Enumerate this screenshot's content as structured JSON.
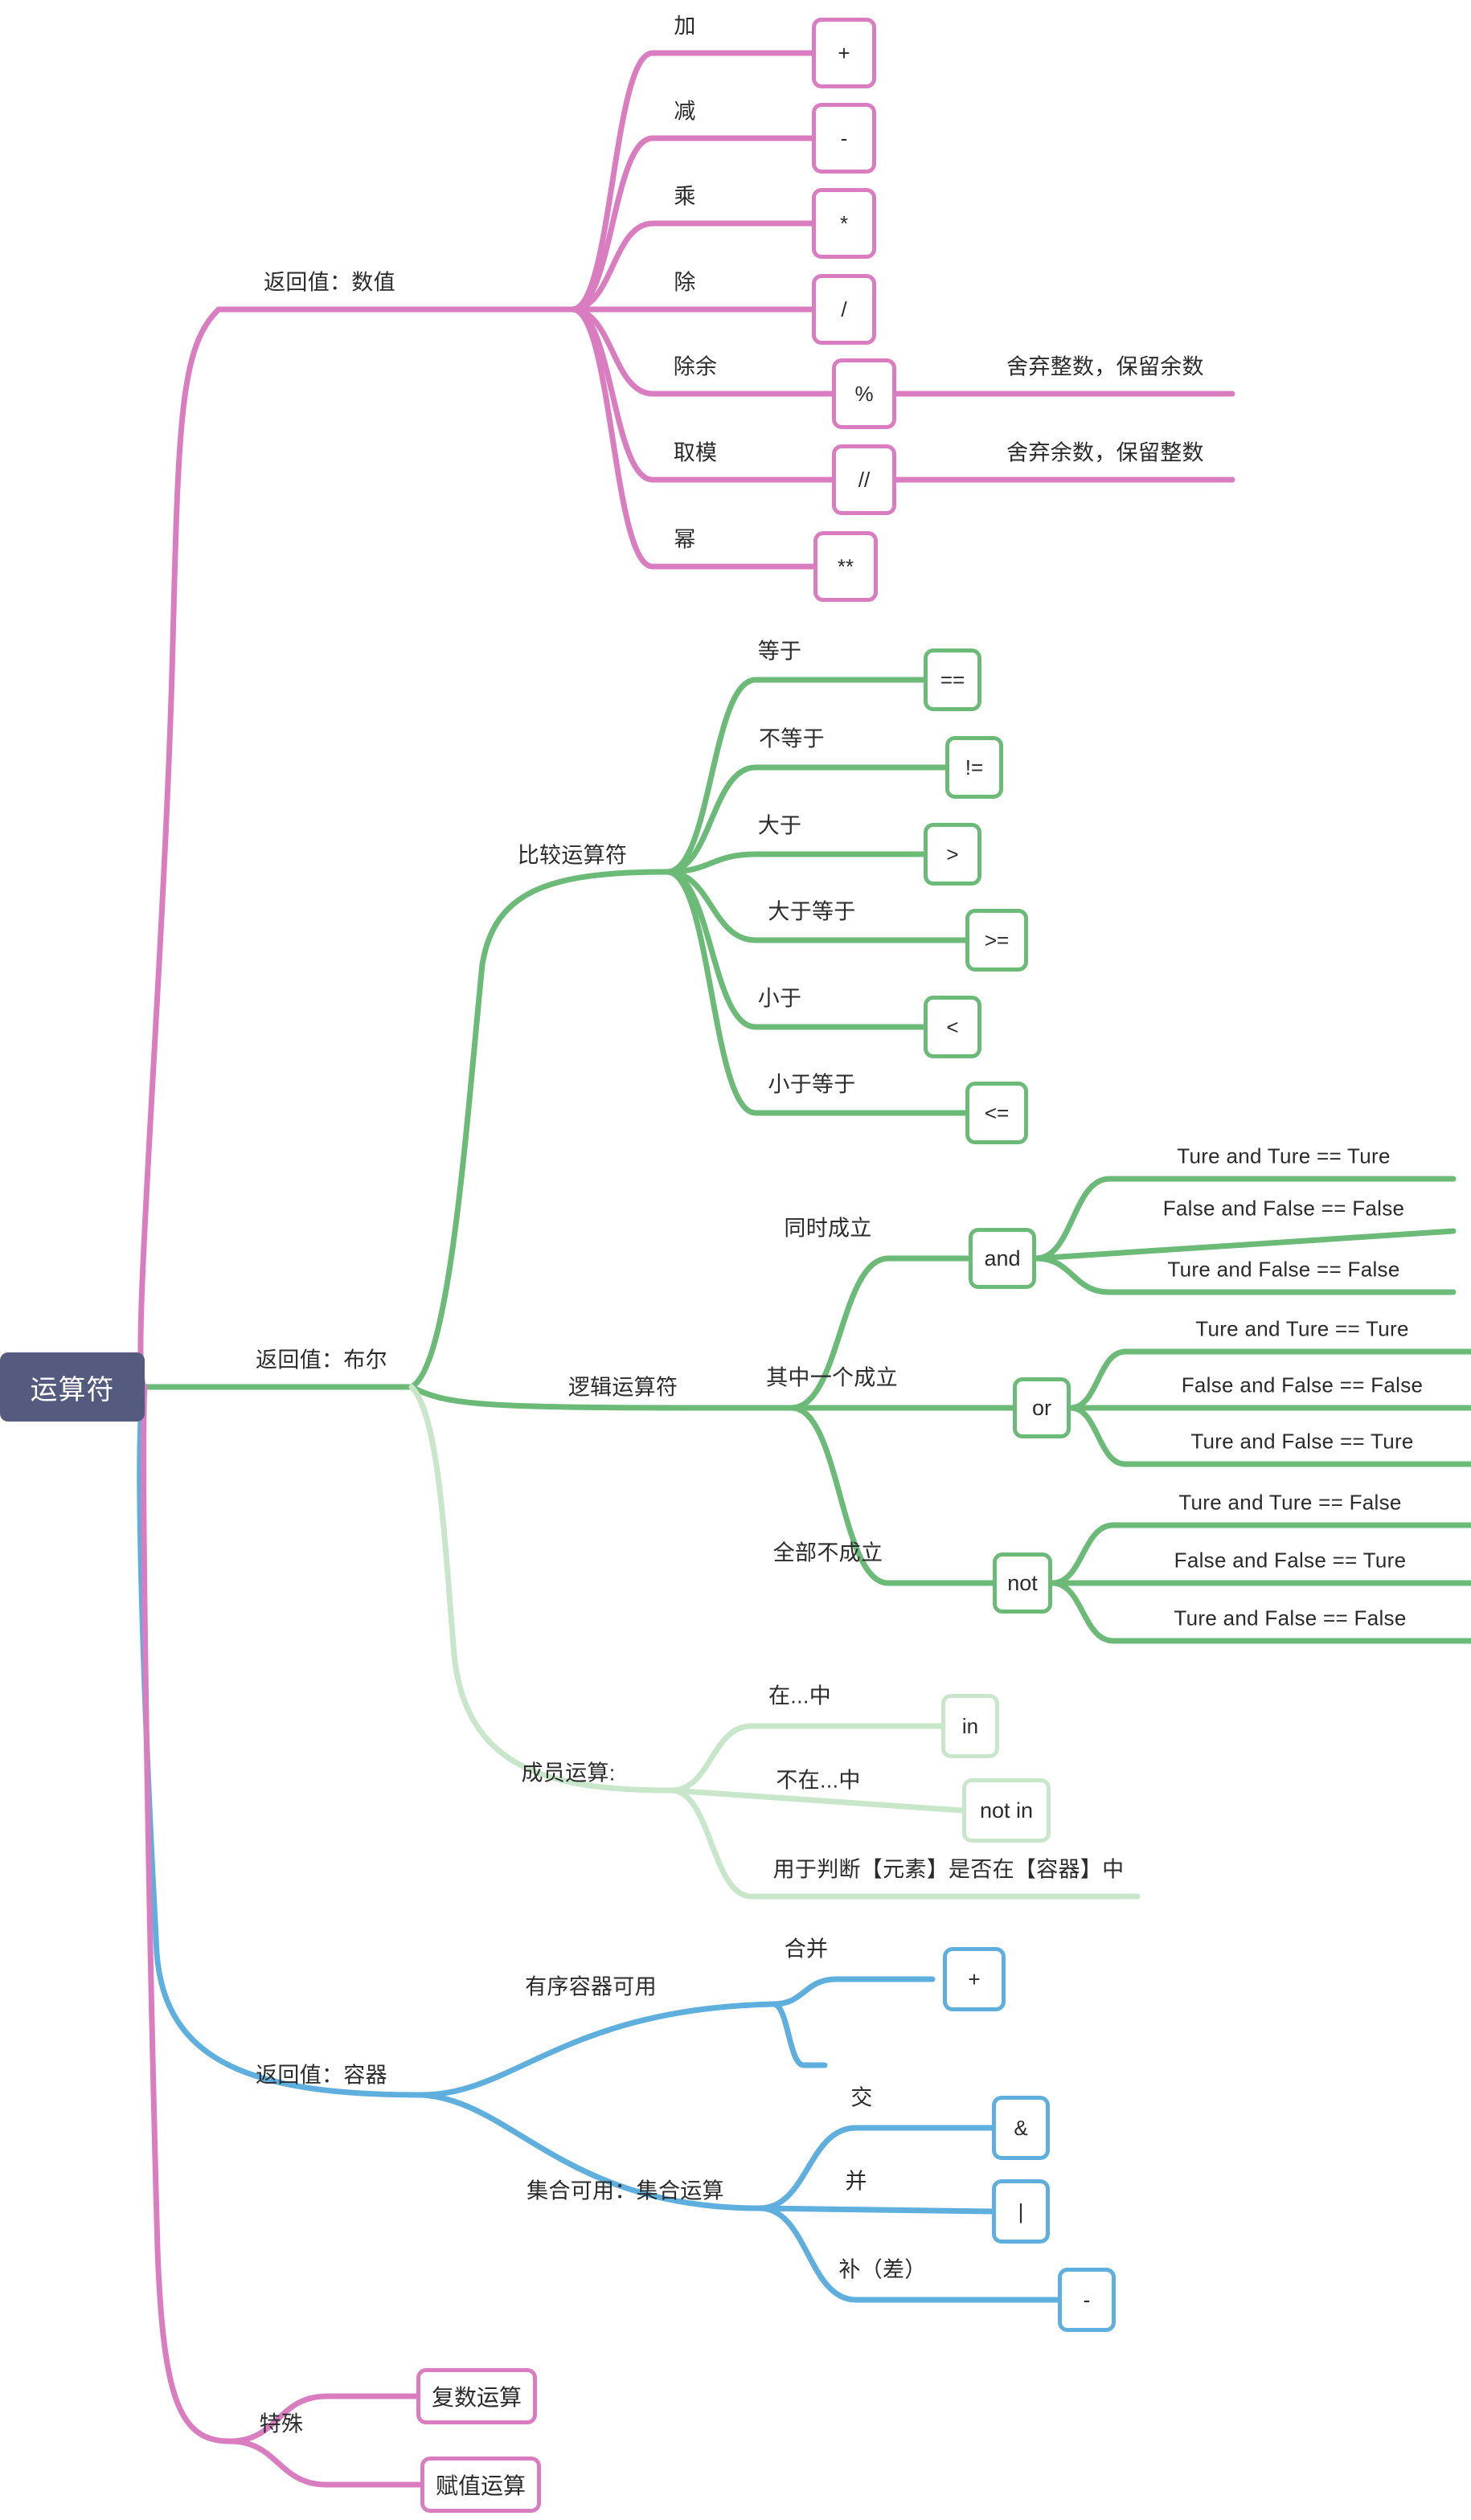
{
  "title": "运算符思维导图",
  "colors": {
    "pink": "#d97dc0",
    "green": "#6cba78",
    "green_light": "#c8e6c9",
    "blue": "#5eafdd",
    "root_bg": "#545b7e",
    "root_text": "#ffffff",
    "text": "#2b2b2b",
    "background": "#ffffff"
  },
  "root": {
    "label": "运算符"
  },
  "branches": {
    "numeric": {
      "label": "返回值：数值",
      "color": "#d97dc0",
      "children": [
        {
          "label": "加",
          "op": "+",
          "note": ""
        },
        {
          "label": "减",
          "op": "-",
          "note": ""
        },
        {
          "label": "乘",
          "op": "*",
          "note": ""
        },
        {
          "label": "除",
          "op": "/",
          "note": ""
        },
        {
          "label": "除余",
          "op": "%",
          "note": "舍弃整数，保留余数"
        },
        {
          "label": "取模",
          "op": "//",
          "note": "舍弃余数，保留整数"
        },
        {
          "label": "幂",
          "op": "**",
          "note": ""
        }
      ]
    },
    "boolean": {
      "label": "返回值：布尔",
      "color": "#6cba78",
      "comparison": {
        "label": "比较运算符",
        "children": [
          {
            "label": "等于",
            "op": "=="
          },
          {
            "label": "不等于",
            "op": "!="
          },
          {
            "label": "大于",
            "op": ">"
          },
          {
            "label": "大于等于",
            "op": ">="
          },
          {
            "label": "小于",
            "op": "<"
          },
          {
            "label": "小于等于",
            "op": "<="
          }
        ]
      },
      "logical": {
        "label": "逻辑运算符",
        "children": [
          {
            "label": "同时成立",
            "op": "and",
            "rules": [
              "Ture and Ture  == Ture",
              "False and False == False",
              "Ture and False == False"
            ]
          },
          {
            "label": "其中一个成立",
            "op": "or",
            "rules": [
              "Ture and Ture  == Ture",
              "False and False == False",
              "Ture and False == Ture"
            ]
          },
          {
            "label": "全部不成立",
            "op": "not",
            "rules": [
              "Ture and Ture  == False",
              "False and False == Ture",
              "Ture and False == False"
            ]
          }
        ]
      },
      "membership": {
        "label": "成员运算:",
        "children": [
          {
            "label": "在...中",
            "op": "in"
          },
          {
            "label": "不在...中",
            "op": "not in"
          }
        ],
        "note": "用于判断【元素】是否在【容器】中"
      }
    },
    "container": {
      "label": "返回值：容器",
      "color": "#5eafdd",
      "groups": [
        {
          "label": "有序容器可用",
          "children": [
            {
              "label": "合并",
              "op": "+"
            },
            {
              "label": "",
              "op": ""
            }
          ]
        },
        {
          "label": "集合可用：集合运算",
          "children": [
            {
              "label": "交",
              "op": "&"
            },
            {
              "label": "并",
              "op": "|"
            },
            {
              "label": "补（差）",
              "op": "-"
            }
          ]
        }
      ]
    },
    "special": {
      "label": "特殊",
      "color": "#d97dc0",
      "children": [
        {
          "label": "复数运算"
        },
        {
          "label": "赋值运算"
        }
      ]
    }
  }
}
